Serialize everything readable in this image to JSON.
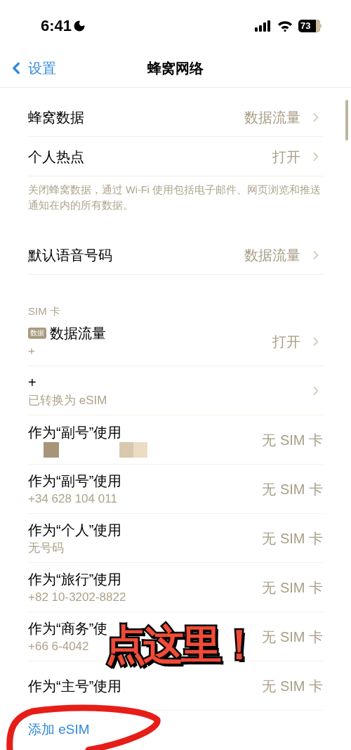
{
  "status_bar": {
    "time": "6:41",
    "battery": "73"
  },
  "nav": {
    "back": "设置",
    "title": "蜂窝网络"
  },
  "section_1": {
    "rows": [
      {
        "title": "蜂窝数据",
        "value": "数据流量"
      },
      {
        "title": "个人热点",
        "value": "打开"
      }
    ],
    "footer": "关闭蜂窝数据，通过 Wi-Fi 使用包括电子邮件、网页浏览和推送通知在内的所有数据。"
  },
  "section_2": {
    "rows": [
      {
        "title": "默认语音号码",
        "value": "数据流量"
      }
    ]
  },
  "sim_section": {
    "header": "SIM 卡",
    "rows": [
      {
        "badge": "数据",
        "title": "数据流量",
        "subtitle": "+",
        "value": "打开",
        "chevron": true,
        "redacted": false
      },
      {
        "title": "+",
        "subtitle": "已转换为 eSIM",
        "chevron": true,
        "redacted": false
      },
      {
        "title": "作为“副号”使用",
        "value": "无 SIM 卡",
        "chevron": false,
        "redacted": true
      },
      {
        "title": "作为“副号”使用",
        "subtitle": "+34 628 104 011",
        "value": "无 SIM 卡",
        "chevron": false,
        "redacted": false
      },
      {
        "title": "作为“个人”使用",
        "subtitle": "无号码",
        "value": "无 SIM 卡",
        "chevron": false,
        "redacted": false
      },
      {
        "title": "作为“旅行”使用",
        "subtitle": "+82 10-3202-8822",
        "value": "无 SIM 卡",
        "chevron": false,
        "redacted": false
      },
      {
        "title": "作为“商务”使",
        "subtitle": "+66 6-4042",
        "value": "无 SIM 卡",
        "chevron": false,
        "redacted": false
      },
      {
        "title": "作为“主号”使用",
        "value": "无 SIM 卡",
        "chevron": false,
        "redacted": false
      }
    ],
    "add_link": "添加 eSIM"
  },
  "annotation": {
    "text": "点这里！"
  }
}
